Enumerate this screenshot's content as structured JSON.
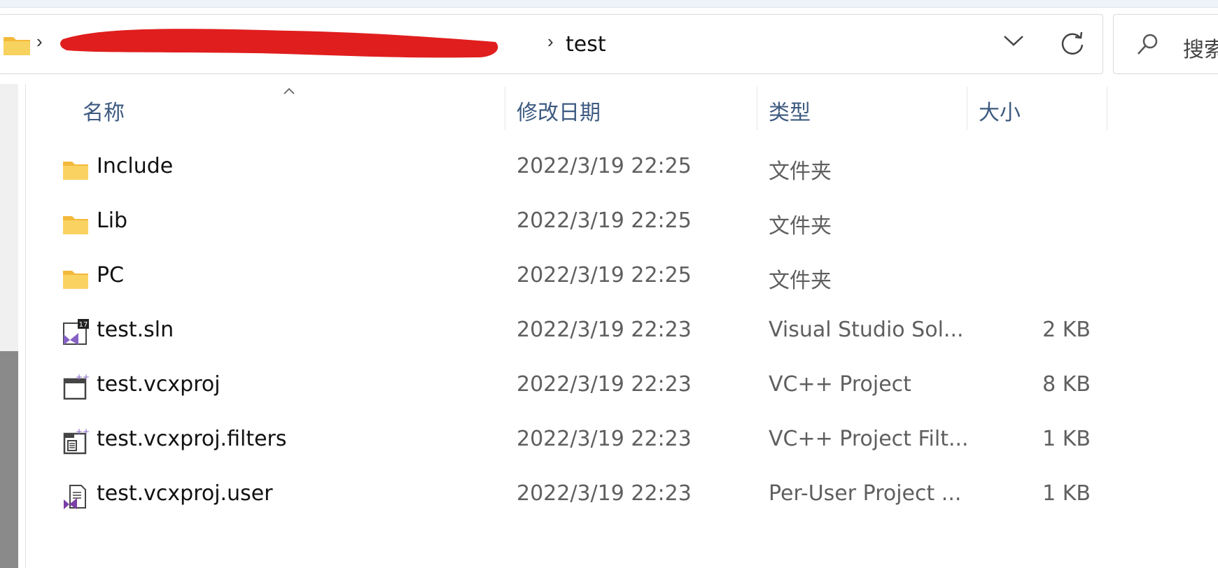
{
  "address_bar": {
    "breadcrumb_hidden": "",
    "current_folder": "test"
  },
  "search": {
    "placeholder": "搜索"
  },
  "columns": {
    "name": "名称",
    "modified": "修改日期",
    "type": "类型",
    "size": "大小"
  },
  "files": [
    {
      "name": "Include",
      "modified": "2022/3/19 22:25",
      "type": "文件夹",
      "size": "",
      "icon": "folder-icon"
    },
    {
      "name": "Lib",
      "modified": "2022/3/19 22:25",
      "type": "文件夹",
      "size": "",
      "icon": "folder-icon"
    },
    {
      "name": "PC",
      "modified": "2022/3/19 22:25",
      "type": "文件夹",
      "size": "",
      "icon": "folder-icon"
    },
    {
      "name": "test.sln",
      "modified": "2022/3/19 22:23",
      "type": "Visual Studio Sol...",
      "size": "2 KB",
      "icon": "vs-solution-icon"
    },
    {
      "name": "test.vcxproj",
      "modified": "2022/3/19 22:23",
      "type": "VC++ Project",
      "size": "8 KB",
      "icon": "vcxproj-icon"
    },
    {
      "name": "test.vcxproj.filters",
      "modified": "2022/3/19 22:23",
      "type": "VC++ Project Filt...",
      "size": "1 KB",
      "icon": "vcxproj-filters-icon"
    },
    {
      "name": "test.vcxproj.user",
      "modified": "2022/3/19 22:23",
      "type": "Per-User Project ...",
      "size": "1 KB",
      "icon": "vcxproj-user-icon"
    }
  ],
  "colors": {
    "header_text": "#3d5a80",
    "folder_yellow": "#f8c947",
    "vs_purple": "#8661c5",
    "redaction": "#e01e1e"
  }
}
